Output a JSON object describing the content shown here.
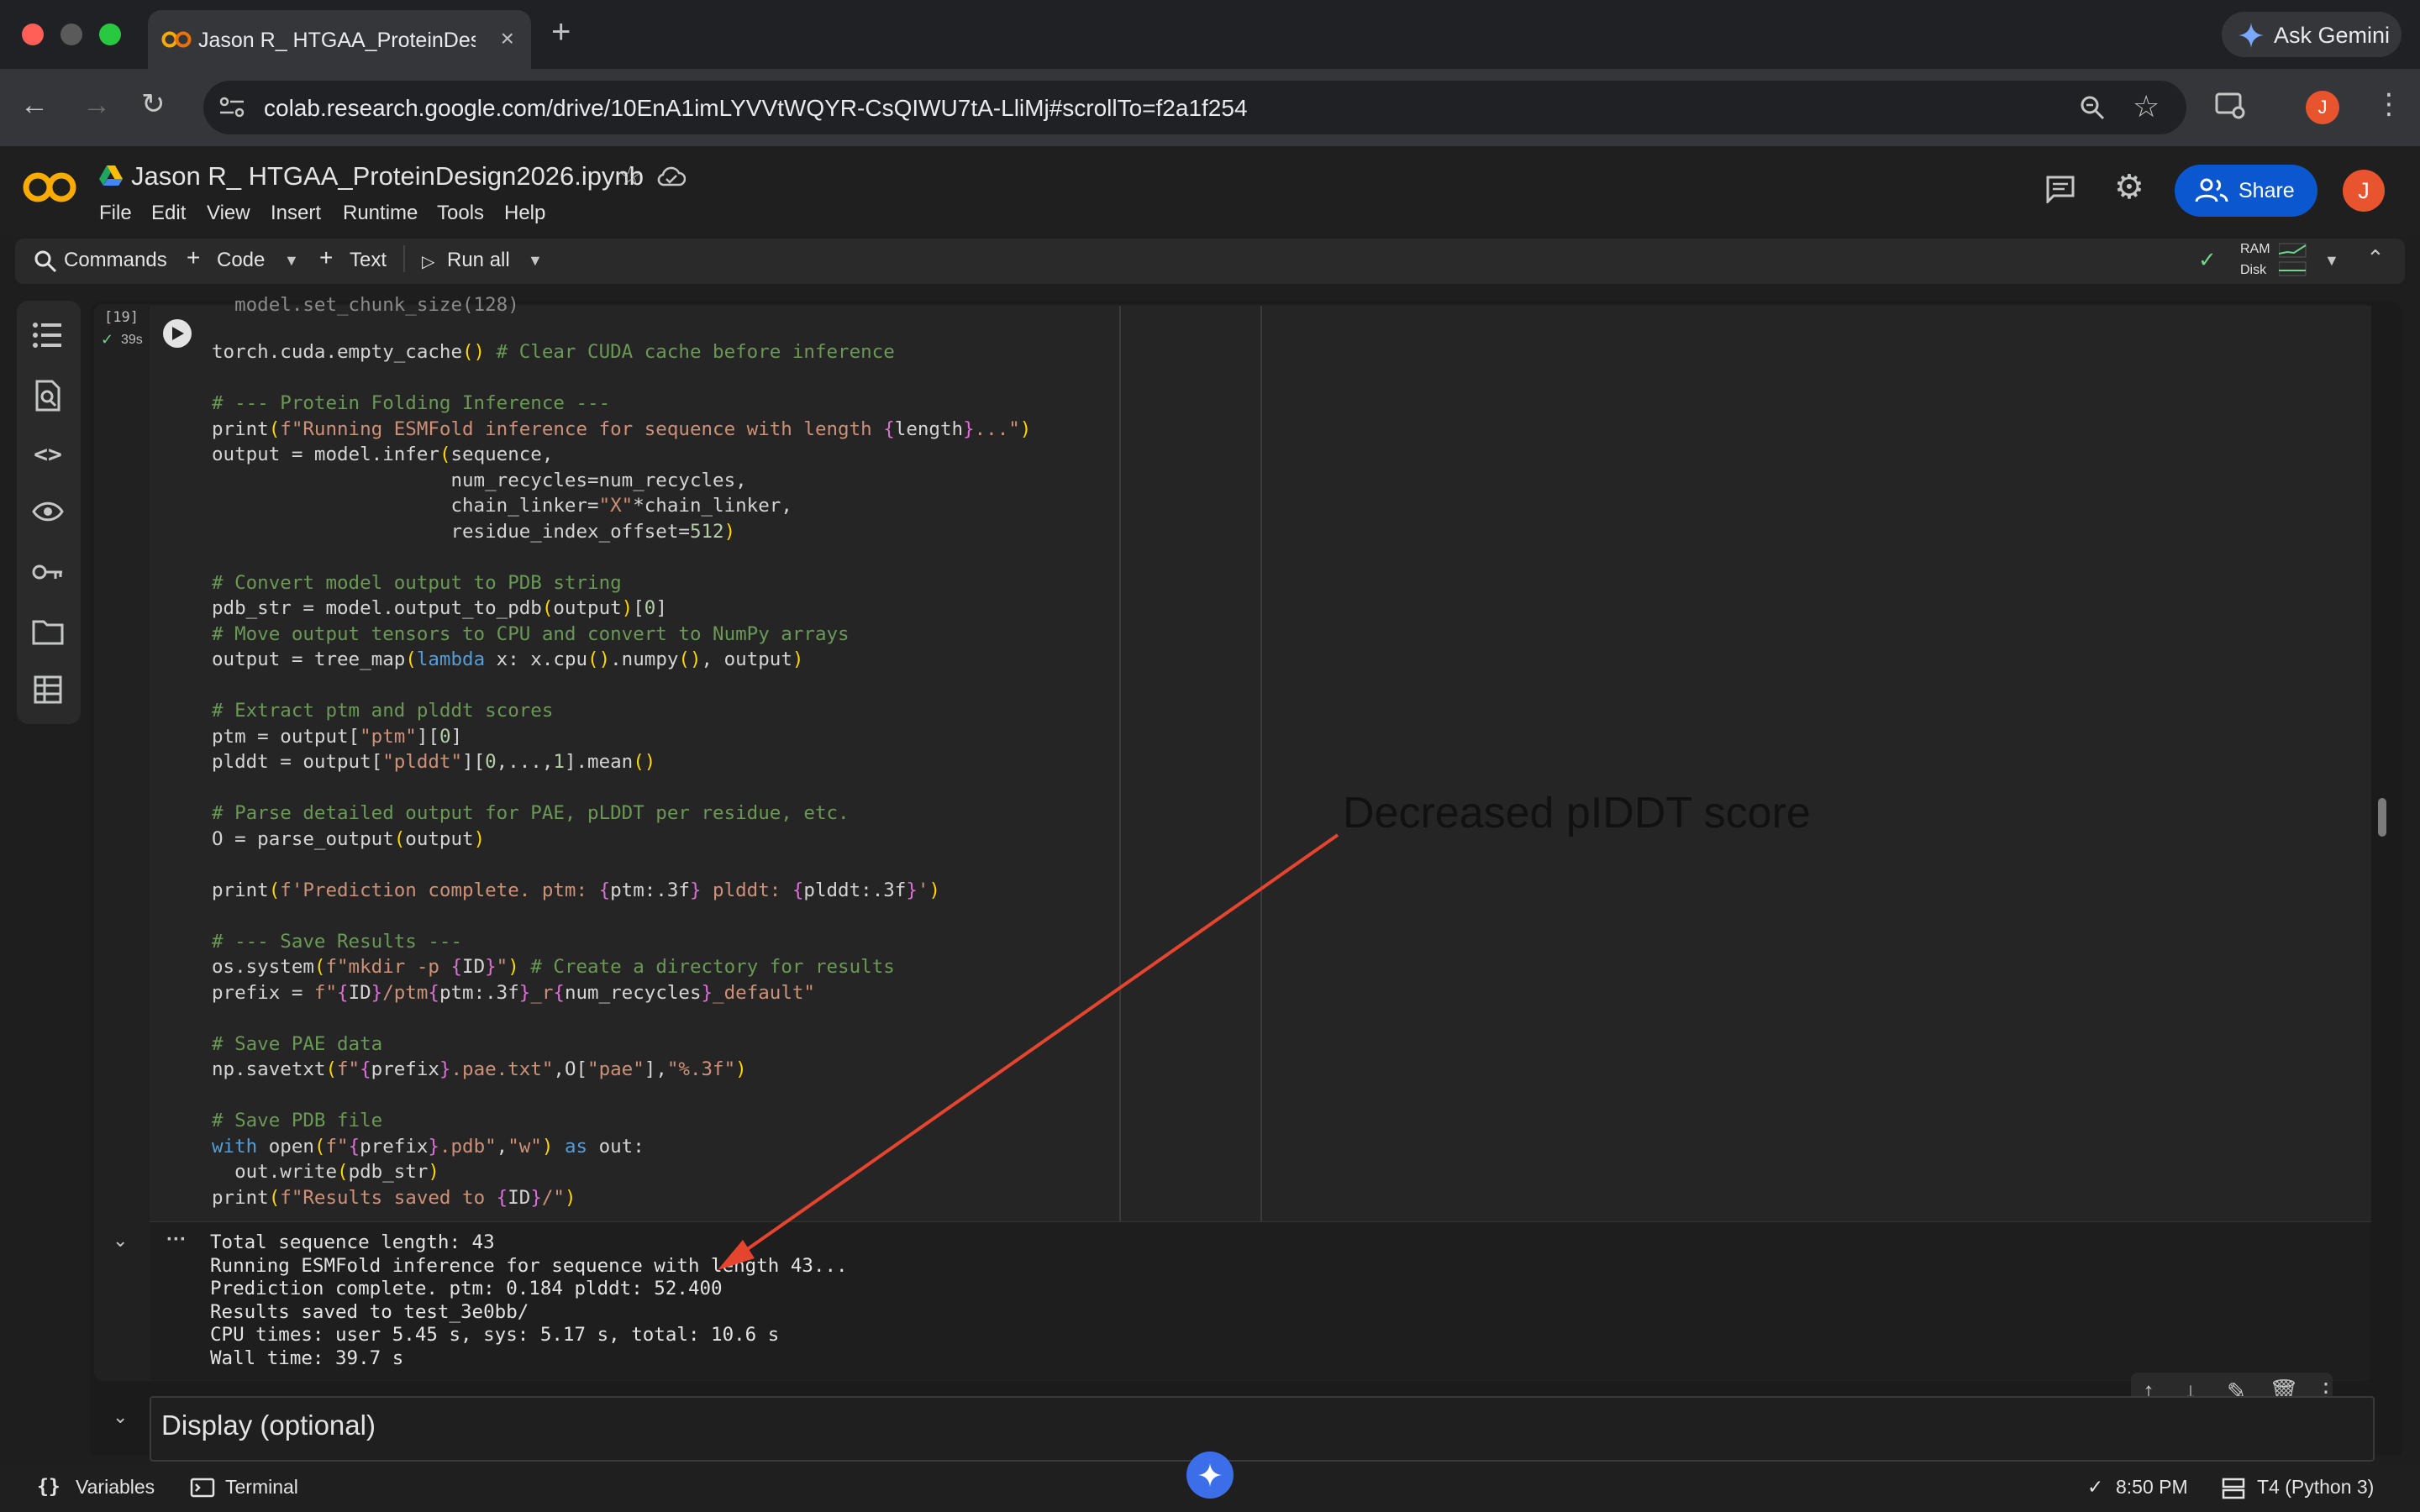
{
  "browser": {
    "tab_title": "Jason R_ HTGAA_ProteinDesi",
    "url": "colab.research.google.com/drive/10EnA1imLYVVtWQYR-CsQIWU7tA-LliMj#scrollTo=f2a1f254",
    "ask_gemini_label": "Ask Gemini",
    "profile_initial": "J"
  },
  "colab": {
    "notebook_title": "Jason R_ HTGAA_ProteinDesign2026.ipynb",
    "menu": [
      "File",
      "Edit",
      "View",
      "Insert",
      "Runtime",
      "Tools",
      "Help"
    ],
    "share_label": "Share",
    "user_initial": "J"
  },
  "command_bar": {
    "commands_label": "Commands",
    "code_label": "Code",
    "text_label": "Text",
    "run_all_label": "Run all",
    "ram_label": "RAM",
    "disk_label": "Disk"
  },
  "cell": {
    "execution_count": "[19]",
    "exec_time": "39s",
    "output_lines": [
      "Total sequence length: 43",
      "Running ESMFold inference for sequence with length 43...",
      "Prediction complete. ptm: 0.184 plddt: 52.400",
      "Results saved to test_3e0bb/",
      "CPU times: user 5.45 s, sys: 5.17 s, total: 10.6 s",
      "Wall time: 39.7 s"
    ]
  },
  "next_cell": {
    "heading": "Display (optional)"
  },
  "annotation": {
    "text": "Decreased pIDDT score",
    "arrow_color": "#e5452f"
  },
  "status_bar": {
    "variables_label": "Variables",
    "terminal_label": "Terminal",
    "time": "8:50 PM",
    "runtime": "T4 (Python 3)"
  },
  "colors": {
    "accent": "#0b57d0",
    "background": "#1e1e1e"
  }
}
